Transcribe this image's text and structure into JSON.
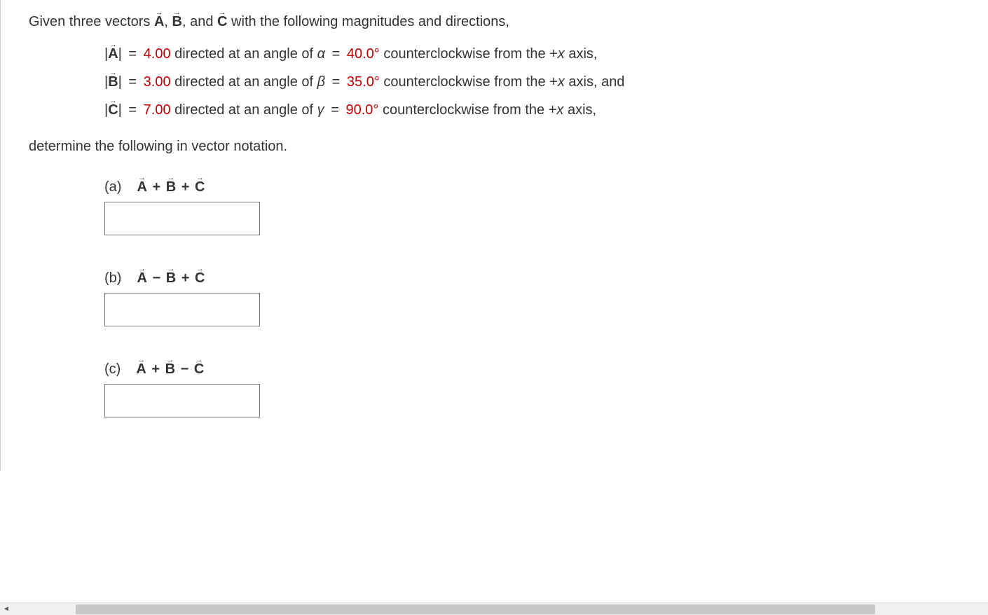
{
  "problem": {
    "intro_prefix": "Given three vectors ",
    "intro_mid1": ", ",
    "intro_mid2": ", and ",
    "intro_suffix": " with the following magnitudes and directions,",
    "vectors": {
      "A": {
        "name": "A",
        "mag": "4.00",
        "angle_sym": "α",
        "angle_val": "40.0°",
        "suffix": "counterclockwise from the +",
        "axis_var": "x",
        "axis_tail": " axis,"
      },
      "B": {
        "name": "B",
        "mag": "3.00",
        "angle_sym": "β",
        "angle_val": "35.0°",
        "suffix": "counterclockwise from the +",
        "axis_var": "x",
        "axis_tail": " axis, and"
      },
      "C": {
        "name": "C",
        "mag": "7.00",
        "angle_sym": "γ",
        "angle_val": "90.0°",
        "suffix": "counterclockwise from the +",
        "axis_var": "x",
        "axis_tail": " axis,"
      }
    },
    "determine": "determine the following in vector notation.",
    "parts": {
      "a": {
        "label": "(a)",
        "op1": "+",
        "op2": "+"
      },
      "b": {
        "label": "(b)",
        "op1": "−",
        "op2": "+"
      },
      "c": {
        "label": "(c)",
        "op1": "+",
        "op2": "−"
      }
    },
    "literals": {
      "directed": " directed at an angle of ",
      "eq": " = "
    }
  }
}
